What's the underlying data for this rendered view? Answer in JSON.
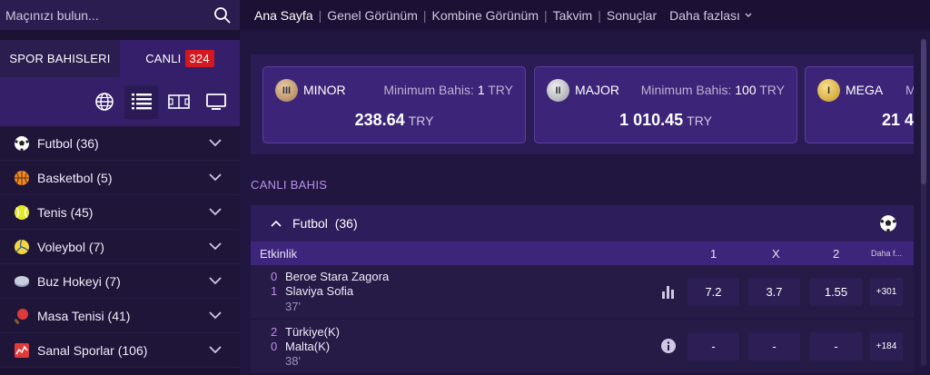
{
  "search": {
    "placeholder": "Maçınızı bulun..."
  },
  "tabs": {
    "sports": "SPOR BAHISLERI",
    "live": "CANLI",
    "live_count": "324"
  },
  "sports": [
    {
      "label": "Futbol (36)",
      "icon": "football-icon"
    },
    {
      "label": "Basketbol (5)",
      "icon": "basketball-icon"
    },
    {
      "label": "Tenis (45)",
      "icon": "tennis-icon"
    },
    {
      "label": "Voleybol (7)",
      "icon": "volleyball-icon"
    },
    {
      "label": "Buz Hokeyi (7)",
      "icon": "ice-hockey-icon"
    },
    {
      "label": "Masa Tenisi (41)",
      "icon": "table-tennis-icon"
    },
    {
      "label": "Sanal Sporlar (106)",
      "icon": "virtual-sports-icon"
    }
  ],
  "nav": {
    "items": [
      "Ana Sayfa",
      "Genel Görünüm",
      "Kombine Görünüm",
      "Takvim",
      "Sonuçlar"
    ],
    "more": "Daha fazlası"
  },
  "jackpots": [
    {
      "name": "MINOR",
      "min_label": "Minimum Bahis:",
      "min_value": "1",
      "min_currency": "TRY",
      "amount": "238.64",
      "currency": "TRY",
      "coin": "III",
      "coin_color": "#c9a27a"
    },
    {
      "name": "MAJOR",
      "min_label": "Minimum Bahis:",
      "min_value": "100",
      "min_currency": "TRY",
      "amount": "1 010.45",
      "currency": "TRY",
      "coin": "II",
      "coin_color": "#c8c8cc"
    },
    {
      "name": "MEGA",
      "min_label": "M",
      "min_value": "",
      "min_currency": "",
      "amount": "21 4",
      "currency": "",
      "coin": "I",
      "coin_color": "#e0b94a"
    }
  ],
  "live": {
    "title": "CANLI BAHIS",
    "section_title": "Futbol",
    "section_count": "(36)",
    "columns": {
      "event": "Etkinlik",
      "c1": "1",
      "cx": "X",
      "c2": "2",
      "more": "Daha f..."
    },
    "events": [
      {
        "score1": "0",
        "team1": "Beroe Stara Zagora",
        "score2": "1",
        "team2": "Slaviya Sofia",
        "minute": "37'",
        "o1": "7.2",
        "ox": "3.7",
        "o2": "1.55",
        "more": "+301",
        "stat": "stats-icon"
      },
      {
        "score1": "2",
        "team1": "Türkiye(K)",
        "score2": "0",
        "team2": "Malta(K)",
        "minute": "38'",
        "o1": "-",
        "ox": "-",
        "o2": "-",
        "more": "+184",
        "stat": "info-icon"
      }
    ]
  },
  "colors": {
    "accent": "#b98fe8",
    "badge": "#d3181f",
    "background": "#1c1135"
  }
}
